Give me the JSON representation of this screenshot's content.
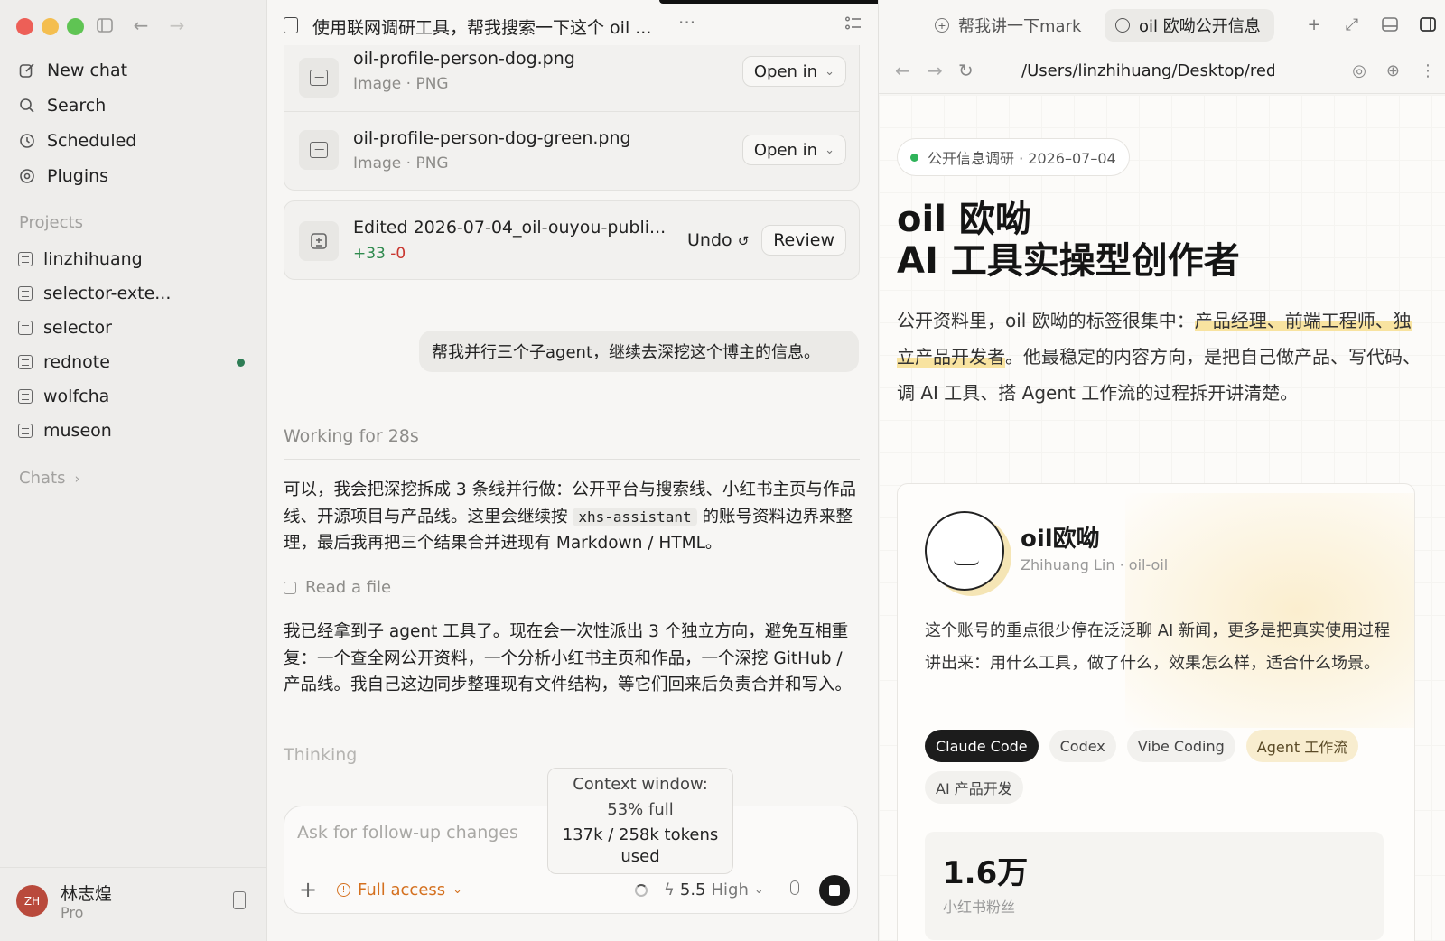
{
  "sidebar": {
    "nav": [
      {
        "label": "New chat",
        "icon": "compose-icon"
      },
      {
        "label": "Search",
        "icon": "search-icon"
      },
      {
        "label": "Scheduled",
        "icon": "clock-icon"
      },
      {
        "label": "Plugins",
        "icon": "plugin-icon"
      }
    ],
    "projects_label": "Projects",
    "projects": [
      {
        "label": "linzhihuang"
      },
      {
        "label": "selector-exte..."
      },
      {
        "label": "selector"
      },
      {
        "label": "rednote",
        "active_dot": true
      },
      {
        "label": "wolfcha"
      },
      {
        "label": "museon"
      }
    ],
    "chats_label": "Chats",
    "user": {
      "initials": "ZH",
      "name": "林志煌",
      "plan": "Pro"
    }
  },
  "chat": {
    "title": "使用联网调研工具，帮我搜索一下这个 oil ...",
    "more": "···",
    "files": [
      {
        "name": "oil-profile-person-dog.png",
        "meta": "Image · PNG",
        "action": "Open in"
      },
      {
        "name": "oil-profile-person-dog-green.png",
        "meta": "Image · PNG",
        "action": "Open in"
      }
    ],
    "edit": {
      "title": "Edited 2026-07-04_oil-ouyou-publi...",
      "added": "+33",
      "removed": "-0",
      "undo": "Undo",
      "review": "Review"
    },
    "user_message": "帮我并行三个子agent，继续去深挖这个博主的信息。",
    "working": "Working for 28s",
    "para1_a": "可以，我会把深挖拆成 3 条线并行做：公开平台与搜索线、小红书主页与作品线、开源项目与产品线。这里会继续按 ",
    "para1_code": "xhs-assistant",
    "para1_b": " 的账号资料边界来整理，最后我再把三个结果合并进现有 Markdown / HTML。",
    "read_file": "Read a file",
    "para2": "我已经拿到子 agent 工具了。现在会一次性派出 3 个独立方向，避免互相重复：一个查全网公开资料，一个分析小红书主页和作品，一个深挖 GitHub / 产品线。我自己这边同步整理现有文件结构，等它们回来后负责合并和写入。",
    "thinking": "Thinking",
    "composer": {
      "placeholder": "Ask for follow-up changes",
      "access": "Full access",
      "model": "5.5",
      "level": "High"
    },
    "tooltip": {
      "line1": "Context window:",
      "line2": "53% full",
      "line3": "137k / 258k tokens",
      "line4": "used"
    }
  },
  "browser": {
    "tabs": [
      {
        "label": "帮我讲一下mark"
      },
      {
        "label": "oil 欧呦公开信息"
      }
    ],
    "url": "/Users/linzhihuang/Desktop/redn",
    "page": {
      "badge": "公开信息调研 · 2026–07–04",
      "title_line1": "oil 欧呦",
      "title_line2": "AI 工具实操型创作者",
      "intro_a": "公开资料里，oil 欧呦的标签很集中：",
      "intro_hl": "产品经理、前端工程师、独立产品开发者",
      "intro_b": "。他最稳定的内容方向，是把自己做产品、写代码、调 AI 工具、搭 Agent 工作流的过程拆开讲清楚。",
      "profile": {
        "name": "oil欧呦",
        "sub": "Zhihuang Lin · oil-oil",
        "desc": "这个账号的重点很少停在泛泛聊 AI 新闻，更多是把真实使用过程讲出来：用什么工具，做了什么，效果怎么样，适合什么场景。",
        "tags": [
          "Claude Code",
          "Codex",
          "Vibe Coding",
          "Agent 工作流",
          "AI 产品开发"
        ],
        "stat_value": "1.6万",
        "stat_label": "小红书粉丝"
      }
    }
  }
}
